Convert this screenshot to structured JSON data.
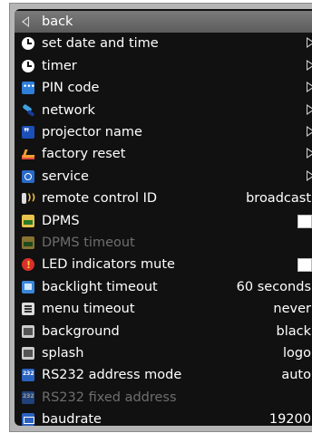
{
  "menu": {
    "items": [
      {
        "label": "back",
        "icon": "back-arrow-icon",
        "value": null,
        "control": "none",
        "selected": true,
        "disabled": false
      },
      {
        "label": "set date and time",
        "icon": "clock-icon",
        "value": null,
        "control": "submenu",
        "selected": false,
        "disabled": false
      },
      {
        "label": "timer",
        "icon": "clock-icon",
        "value": null,
        "control": "submenu",
        "selected": false,
        "disabled": false
      },
      {
        "label": "PIN code",
        "icon": "pin-code-icon",
        "value": null,
        "control": "submenu",
        "selected": false,
        "disabled": false
      },
      {
        "label": "network",
        "icon": "network-icon",
        "value": null,
        "control": "submenu",
        "selected": false,
        "disabled": false
      },
      {
        "label": "projector name",
        "icon": "projector-name-icon",
        "value": null,
        "control": "submenu",
        "selected": false,
        "disabled": false
      },
      {
        "label": "factory reset",
        "icon": "factory-reset-icon",
        "value": null,
        "control": "submenu",
        "selected": false,
        "disabled": false
      },
      {
        "label": "service",
        "icon": "service-icon",
        "value": null,
        "control": "submenu",
        "selected": false,
        "disabled": false
      },
      {
        "label": "remote control ID",
        "icon": "remote-control-icon",
        "value": "broadcast",
        "control": "value",
        "selected": false,
        "disabled": false
      },
      {
        "label": "DPMS",
        "icon": "dpms-icon",
        "value": null,
        "control": "checkbox",
        "selected": false,
        "disabled": false
      },
      {
        "label": "DPMS timeout",
        "icon": "dpms-icon",
        "value": null,
        "control": "none",
        "selected": false,
        "disabled": true
      },
      {
        "label": "LED indicators mute",
        "icon": "led-icon",
        "value": null,
        "control": "checkbox",
        "selected": false,
        "disabled": false
      },
      {
        "label": "backlight timeout",
        "icon": "backlight-icon",
        "value": "60 seconds",
        "control": "value",
        "selected": false,
        "disabled": false
      },
      {
        "label": "menu timeout",
        "icon": "menu-icon",
        "value": "never",
        "control": "value",
        "selected": false,
        "disabled": false
      },
      {
        "label": "background",
        "icon": "background-icon",
        "value": "black",
        "control": "value",
        "selected": false,
        "disabled": false
      },
      {
        "label": "splash",
        "icon": "background-icon",
        "value": "logo",
        "control": "value",
        "selected": false,
        "disabled": false
      },
      {
        "label": "RS232 address mode",
        "icon": "rs232-icon",
        "value": "auto",
        "control": "value",
        "selected": false,
        "disabled": false
      },
      {
        "label": "RS232 fixed address",
        "icon": "rs232-icon",
        "value": null,
        "control": "none",
        "selected": false,
        "disabled": true
      },
      {
        "label": "baudrate",
        "icon": "baudrate-icon",
        "value": "19200",
        "control": "value",
        "selected": false,
        "disabled": false
      }
    ]
  },
  "colors": {
    "panel_bg": "#111111",
    "frame_bg": "#b5b5b5",
    "text": "#ffffff",
    "disabled_text": "#6e6e6e",
    "selected_bg": "#6a6a6a"
  }
}
